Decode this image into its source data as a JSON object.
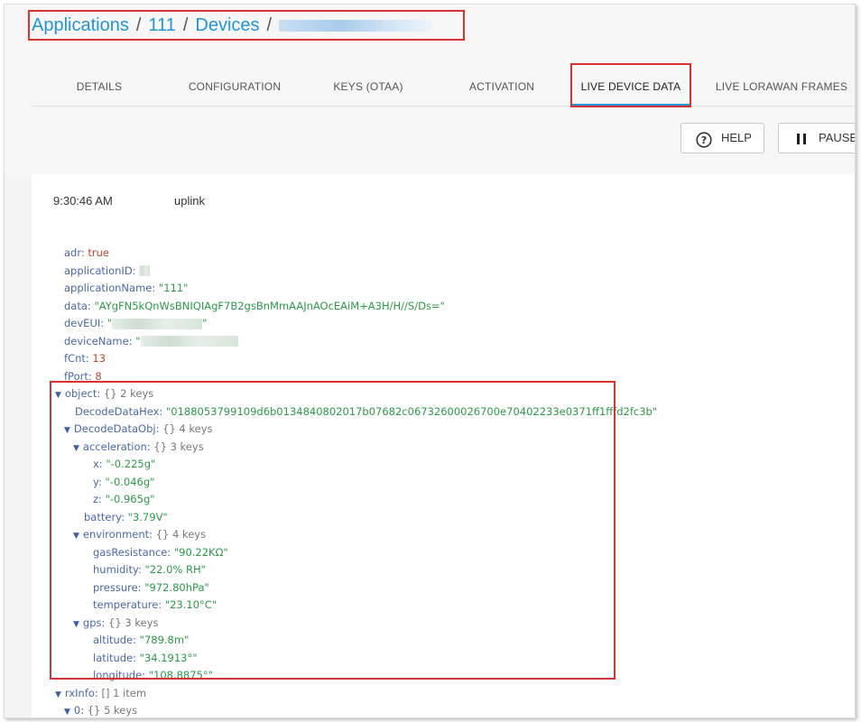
{
  "breadcrumb": {
    "applications": "Applications",
    "sep1": "/",
    "app_id": "111",
    "sep2": "/",
    "devices": "Devices",
    "sep3": "/"
  },
  "tabs": [
    "DETAILS",
    "CONFIGURATION",
    "KEYS (OTAA)",
    "ACTIVATION",
    "LIVE DEVICE DATA",
    "LIVE LORAWAN FRAMES"
  ],
  "active_tab": "LIVE DEVICE DATA",
  "buttons": {
    "help": "HELP",
    "pause": "PAUSE"
  },
  "event": {
    "time": "9:30:46 AM",
    "type": "uplink"
  },
  "fields": {
    "adr_key": "adr:",
    "adr_val": "true",
    "appid_key": "applicationID:",
    "appname_key": "applicationName:",
    "appname_val": "\"111\"",
    "data_key": "data:",
    "data_val": "\"AYgFN5kQnWsBNIQIAgF7B2gsBnMmAAJnAOcEAiM+A3H/H//S/Ds=\"",
    "deveui_key": "devEUI:",
    "deveui_val": "\"",
    "devname_key": "deviceName:",
    "devname_val": "\"",
    "fcnt_key": "fCnt:",
    "fcnt_val": "13",
    "fport_key": "fPort:",
    "fport_val": "8",
    "object_key": "object:",
    "object_meta": "{}  2 keys",
    "hex_key": "DecodeDataHex:",
    "hex_val": "\"0188053799109d6b0134840802017b07682c06732600026700e70402233e0371ff1fffd2fc3b\"",
    "obj_key": "DecodeDataObj:",
    "obj_meta": "{}  4 keys",
    "accel_key": "acceleration:",
    "accel_meta": "{}  3 keys",
    "x_key": "x:",
    "x_val": "\"-0.225g\"",
    "y_key": "y:",
    "y_val": "\"-0.046g\"",
    "z_key": "z:",
    "z_val": "\"-0.965g\"",
    "batt_key": "battery:",
    "batt_val": "\"3.79V\"",
    "env_key": "environment:",
    "env_meta": "{}  4 keys",
    "gas_key": "gasResistance:",
    "gas_val": "\"90.22KΩ\"",
    "hum_key": "humidity:",
    "hum_val": "\"22.0% RH\"",
    "pres_key": "pressure:",
    "pres_val": "\"972.80hPa\"",
    "temp_key": "temperature:",
    "temp_val": "\"23.10°C\"",
    "gps_key": "gps:",
    "gps_meta": "{}  3 keys",
    "alt_key": "altitude:",
    "alt_val": "\"789.8m\"",
    "lat_key": "latitude:",
    "lat_val": "\"34.1913°\"",
    "lon_key": "longitude:",
    "lon_val": "\"108.8875°\"",
    "rxinfo_key": "rxInfo:",
    "rxinfo_meta": "[]  1 item",
    "rx0_key": "0:",
    "rx0_meta": "{}  5 keys"
  },
  "colors": {
    "accent": "#2196d6",
    "highlight": "#d9312f",
    "string": "#2a9a4a",
    "number": "#c0452e",
    "key": "#4a68a8"
  }
}
